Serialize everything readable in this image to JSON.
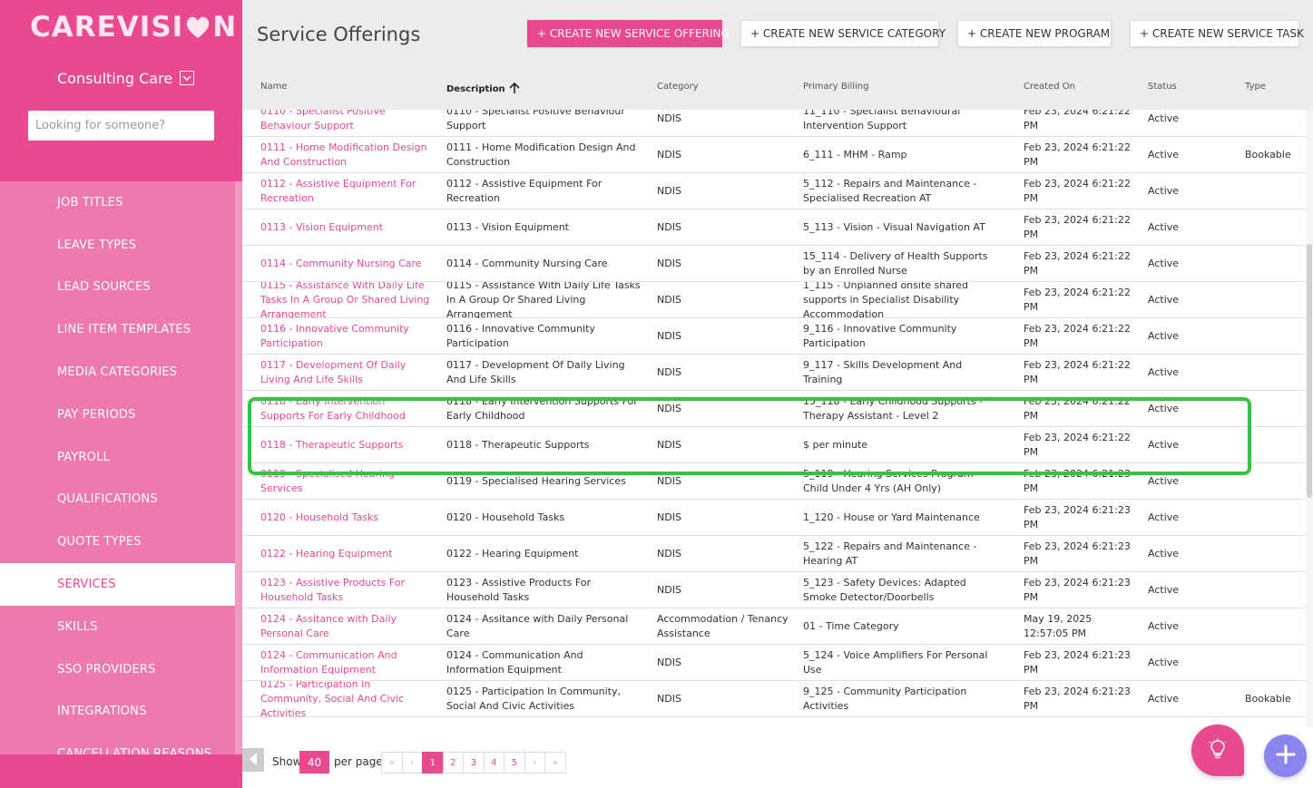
{
  "sidebar": {
    "logo_left": "CAREVISI",
    "logo_right": "N",
    "org": "Consulting Care",
    "search_placeholder": "Looking for someone?",
    "items": [
      {
        "label": "JOB TITLES",
        "active": false
      },
      {
        "label": "LEAVE TYPES",
        "active": false
      },
      {
        "label": "LEAD SOURCES",
        "active": false
      },
      {
        "label": "LINE ITEM TEMPLATES",
        "active": false
      },
      {
        "label": "MEDIA CATEGORIES",
        "active": false
      },
      {
        "label": "PAY PERIODS",
        "active": false
      },
      {
        "label": "PAYROLL",
        "active": false
      },
      {
        "label": "QUALIFICATIONS",
        "active": false
      },
      {
        "label": "QUOTE TYPES",
        "active": false
      },
      {
        "label": "SERVICES",
        "active": true
      },
      {
        "label": "SKILLS",
        "active": false
      },
      {
        "label": "SSO PROVIDERS",
        "active": false
      },
      {
        "label": "INTEGRATIONS",
        "active": false
      },
      {
        "label": "CANCELLATION REASONS",
        "active": false
      }
    ]
  },
  "header": {
    "title": "Service Offerings",
    "btn_new_offering": "+ CREATE NEW SERVICE OFFERING",
    "btn_new_category": "+ CREATE NEW SERVICE CATEGORY",
    "btn_new_program": "+ CREATE NEW PROGRAM",
    "btn_new_task": "+ CREATE NEW SERVICE TASK"
  },
  "table": {
    "columns": {
      "name": "Name",
      "description": "Description",
      "category": "Category",
      "billing": "Primary Billing",
      "created": "Created On",
      "status": "Status",
      "type": "Type"
    },
    "rows": [
      {
        "name": "0110 - Specialist Positive Behaviour Support",
        "description": "0110 - Specialist Positive Behaviour Support",
        "category": "NDIS",
        "billing": "11_110 - Specialist Behavioural Intervention Support",
        "created": "Feb 23, 2024 6:21:22 PM",
        "status": "Active",
        "type": ""
      },
      {
        "name": "0111 - Home Modification Design And Construction",
        "description": "0111 - Home Modification Design And Construction",
        "category": "NDIS",
        "billing": "6_111 - MHM - Ramp",
        "created": "Feb 23, 2024 6:21:22 PM",
        "status": "Active",
        "type": "Bookable"
      },
      {
        "name": "0112 - Assistive Equipment For Recreation",
        "description": "0112 - Assistive Equipment For Recreation",
        "category": "NDIS",
        "billing": "5_112 - Repairs and Maintenance - Specialised Recreation AT",
        "created": "Feb 23, 2024 6:21:22 PM",
        "status": "Active",
        "type": ""
      },
      {
        "name": "0113 - Vision Equipment",
        "description": "0113 - Vision Equipment",
        "category": "NDIS",
        "billing": "5_113 - Vision - Visual Navigation AT",
        "created": "Feb 23, 2024 6:21:22 PM",
        "status": "Active",
        "type": ""
      },
      {
        "name": "0114 - Community Nursing Care",
        "description": "0114 - Community Nursing Care",
        "category": "NDIS",
        "billing": "15_114 - Delivery of Health Supports by an Enrolled Nurse",
        "created": "Feb 23, 2024 6:21:22 PM",
        "status": "Active",
        "type": ""
      },
      {
        "name": "0115 - Assistance With Daily Life Tasks In A Group Or Shared Living Arrangement",
        "description": "0115 - Assistance With Daily Life Tasks In A Group Or Shared Living Arrangement",
        "category": "NDIS",
        "billing": "1_115 - Unplanned onsite shared supports in Specialist Disability Accommodation",
        "created": "Feb 23, 2024 6:21:22 PM",
        "status": "Active",
        "type": ""
      },
      {
        "name": "0116 - Innovative Community Participation",
        "description": "0116 - Innovative Community Participation",
        "category": "NDIS",
        "billing": "9_116 - Innovative Community Participation",
        "created": "Feb 23, 2024 6:21:22 PM",
        "status": "Active",
        "type": ""
      },
      {
        "name": "0117 - Development Of Daily Living And Life Skills",
        "description": "0117 - Development Of Daily Living And Life Skills",
        "category": "NDIS",
        "billing": "9_117 - Skills Development And Training",
        "created": "Feb 23, 2024 6:21:22 PM",
        "status": "Active",
        "type": ""
      },
      {
        "name": "0118 - Early Intervention Supports For Early Childhood",
        "description": "0118 - Early Intervention Supports For Early Childhood",
        "category": "NDIS",
        "billing": "15_118 - Early Childhood Supports - Therapy Assistant - Level 2",
        "created": "Feb 23, 2024 6:21:22 PM",
        "status": "Active",
        "type": ""
      },
      {
        "name": "0118 - Therapeutic Supports",
        "description": "0118 - Therapeutic Supports",
        "category": "NDIS",
        "billing": "$ per minute",
        "created": "Feb 23, 2024 6:21:22 PM",
        "status": "Active",
        "type": ""
      },
      {
        "name": "0119 - Specialised Hearing Services",
        "description": "0119 - Specialised Hearing Services",
        "category": "NDIS",
        "billing": "5_119 - Hearing Services Program - Child Under 4 Yrs (AH Only)",
        "created": "Feb 23, 2024 6:21:23 PM",
        "status": "Active",
        "type": ""
      },
      {
        "name": "0120 - Household Tasks",
        "description": "0120 - Household Tasks",
        "category": "NDIS",
        "billing": "1_120 - House or Yard Maintenance",
        "created": "Feb 23, 2024 6:21:23 PM",
        "status": "Active",
        "type": ""
      },
      {
        "name": "0122 - Hearing Equipment",
        "description": "0122 - Hearing Equipment",
        "category": "NDIS",
        "billing": "5_122 - Repairs and Maintenance - Hearing AT",
        "created": "Feb 23, 2024 6:21:23 PM",
        "status": "Active",
        "type": ""
      },
      {
        "name": "0123 - Assistive Products For Household Tasks",
        "description": "0123 - Assistive Products For Household Tasks",
        "category": "NDIS",
        "billing": "5_123 - Safety Devices: Adapted Smoke Detector/Doorbells",
        "created": "Feb 23, 2024 6:21:23 PM",
        "status": "Active",
        "type": ""
      },
      {
        "name": "0124 - Assitance with Daily Personal Care",
        "description": "0124 - Assitance with Daily Personal Care",
        "category": "Accommodation / Tenancy Assistance",
        "billing": "01 - Time Category",
        "created": "May 19, 2025 12:57:05 PM",
        "status": "Active",
        "type": ""
      },
      {
        "name": "0124 - Communication And Information Equipment",
        "description": "0124 - Communication And Information Equipment",
        "category": "NDIS",
        "billing": "5_124 - Voice Amplifiers For Personal Use",
        "created": "Feb 23, 2024 6:21:23 PM",
        "status": "Active",
        "type": ""
      },
      {
        "name": "0125 - Participation In Community, Social And Civic Activities",
        "description": "0125 - Participation In Community, Social And Civic Activities",
        "category": "NDIS",
        "billing": "9_125 - Community Participation Activities",
        "created": "Feb 23, 2024 6:21:23 PM",
        "status": "Active",
        "type": "Bookable"
      }
    ]
  },
  "pagination": {
    "show_label": "Show",
    "per_page": "40",
    "per_page_label": "per page",
    "first": "«",
    "prev": "‹",
    "pages": [
      "1",
      "2",
      "3",
      "4",
      "5"
    ],
    "next": "›",
    "last": "»",
    "current": "1"
  },
  "colors": {
    "brand": "#e8498f",
    "sidebar_nav": "#ef78ac",
    "highlight": "#35c43f",
    "fab_add": "#8a86ee"
  },
  "icons": {
    "org_select": "chevron-down-icon",
    "sort": "arrow-up-icon",
    "collapse": "caret-left-icon",
    "fab_idea": "lightbulb-icon",
    "fab_add": "plus-icon"
  }
}
